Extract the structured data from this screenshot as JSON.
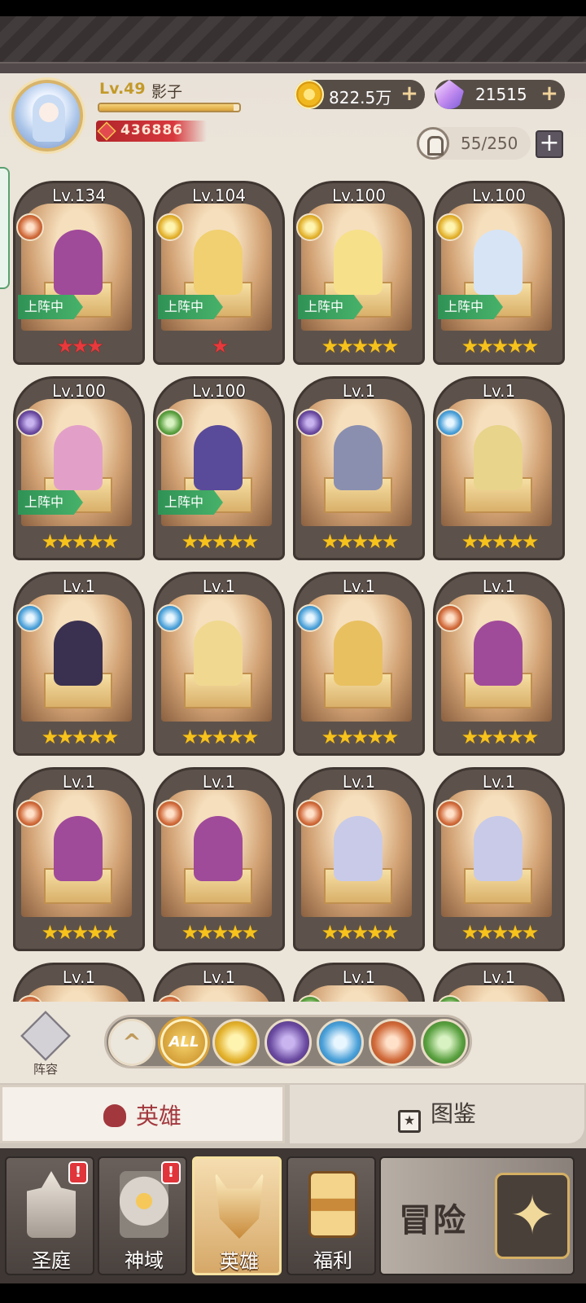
{
  "player": {
    "level_label": "Lv.49",
    "name": "影子",
    "xp_fraction": 0.96,
    "power": "436886"
  },
  "currencies": {
    "gold": "822.5万",
    "diamonds": "21515"
  },
  "hero_capacity": "55/250",
  "heroes": [
    {
      "level": "Lv.134",
      "faction": "beast",
      "deployed": true,
      "stars": 3,
      "star_color": "red",
      "tint": "#a04a9a"
    },
    {
      "level": "Lv.104",
      "faction": "holy",
      "deployed": true,
      "stars": 1,
      "star_color": "red",
      "tint": "#f0d070"
    },
    {
      "level": "Lv.100",
      "faction": "holy",
      "deployed": true,
      "stars": 5,
      "star_color": "gold",
      "tint": "#f6e08a"
    },
    {
      "level": "Lv.100",
      "faction": "holy",
      "deployed": true,
      "stars": 5,
      "star_color": "gold",
      "tint": "#d6e4f6"
    },
    {
      "level": "Lv.100",
      "faction": "dark",
      "deployed": true,
      "stars": 5,
      "star_color": "gold",
      "tint": "#e2a0c8"
    },
    {
      "level": "Lv.100",
      "faction": "nature",
      "deployed": true,
      "stars": 5,
      "star_color": "gold",
      "tint": "#5a4a9a"
    },
    {
      "level": "Lv.1",
      "faction": "dark",
      "deployed": false,
      "stars": 5,
      "star_color": "gold",
      "tint": "#8a8fb0"
    },
    {
      "level": "Lv.1",
      "faction": "light",
      "deployed": false,
      "stars": 5,
      "star_color": "gold",
      "tint": "#e8d48a"
    },
    {
      "level": "Lv.1",
      "faction": "light",
      "deployed": false,
      "stars": 5,
      "star_color": "gold",
      "tint": "#3a3050"
    },
    {
      "level": "Lv.1",
      "faction": "light",
      "deployed": false,
      "stars": 5,
      "star_color": "gold",
      "tint": "#f0d890"
    },
    {
      "level": "Lv.1",
      "faction": "light",
      "deployed": false,
      "stars": 5,
      "star_color": "gold",
      "tint": "#e8c060"
    },
    {
      "level": "Lv.1",
      "faction": "beast",
      "deployed": false,
      "stars": 5,
      "star_color": "gold",
      "tint": "#a04a9a"
    },
    {
      "level": "Lv.1",
      "faction": "beast",
      "deployed": false,
      "stars": 5,
      "star_color": "gold",
      "tint": "#a04a9a"
    },
    {
      "level": "Lv.1",
      "faction": "beast",
      "deployed": false,
      "stars": 5,
      "star_color": "gold",
      "tint": "#a04a9a"
    },
    {
      "level": "Lv.1",
      "faction": "beast",
      "deployed": false,
      "stars": 5,
      "star_color": "gold",
      "tint": "#c8cae8"
    },
    {
      "level": "Lv.1",
      "faction": "beast",
      "deployed": false,
      "stars": 5,
      "star_color": "gold",
      "tint": "#c8cae8"
    },
    {
      "level": "Lv.1",
      "faction": "beast",
      "deployed": false,
      "stars": 5,
      "star_color": "gold",
      "tint": "#a04a9a"
    },
    {
      "level": "Lv.1",
      "faction": "beast",
      "deployed": false,
      "stars": 5,
      "star_color": "gold",
      "tint": "#a04a9a"
    },
    {
      "level": "Lv.1",
      "faction": "nature",
      "deployed": false,
      "stars": 5,
      "star_color": "gold",
      "tint": "#4a80c0"
    },
    {
      "level": "Lv.1",
      "faction": "nature",
      "deployed": false,
      "stars": 5,
      "star_color": "gold",
      "tint": "#4a80c0"
    }
  ],
  "deployed_label": "上阵中",
  "lineup_label": "阵容",
  "filters": [
    {
      "id": "collapse",
      "label": "^",
      "name": "collapse-filter-button"
    },
    {
      "id": "all",
      "label": "ALL",
      "name": "filter-all-button"
    },
    {
      "id": "holy",
      "label": "",
      "name": "filter-holy-icon"
    },
    {
      "id": "dark",
      "label": "",
      "name": "filter-dark-icon"
    },
    {
      "id": "light",
      "label": "",
      "name": "filter-light-icon"
    },
    {
      "id": "beast",
      "label": "",
      "name": "filter-beast-icon"
    },
    {
      "id": "nature",
      "label": "",
      "name": "filter-nature-icon"
    }
  ],
  "tabs": {
    "heroes": "英雄",
    "codex": "图鉴"
  },
  "nav": {
    "sanctum": "圣庭",
    "divine": "神域",
    "heroes": "英雄",
    "welfare": "福利",
    "adventure": "冒险",
    "badge": "!"
  },
  "colors": {
    "accent_red": "#a2373d",
    "deployed_green": "#3a9a5e",
    "star_gold": "#f6c21c",
    "star_red": "#e8393c"
  }
}
